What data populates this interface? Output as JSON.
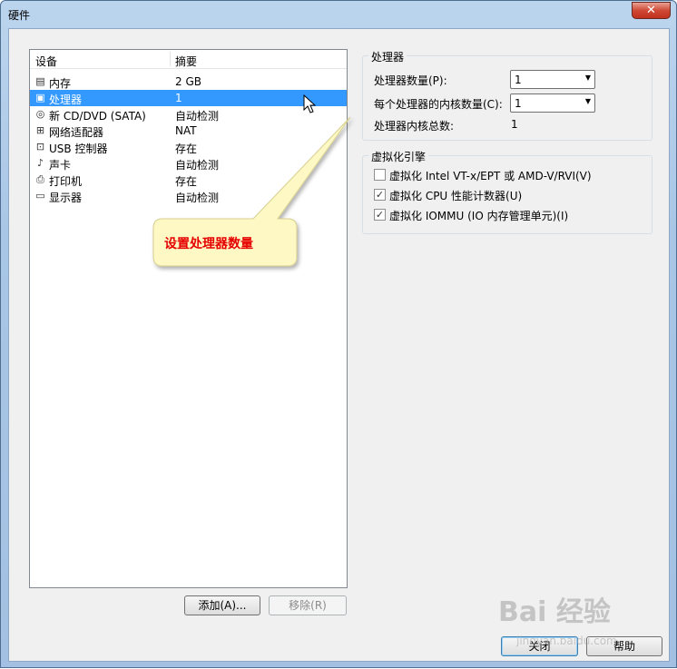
{
  "window": {
    "title": "硬件",
    "close_glyph": "✕"
  },
  "device_list": {
    "header": {
      "device": "设备",
      "summary": "摘要"
    },
    "rows": [
      {
        "icon": "memory-icon",
        "glyph": "▤",
        "name": "内存",
        "summary": "2 GB",
        "selected": false
      },
      {
        "icon": "processor-icon",
        "glyph": "▣",
        "name": "处理器",
        "summary": "1",
        "selected": true
      },
      {
        "icon": "cd-dvd-icon",
        "glyph": "◎",
        "name": "新 CD/DVD (SATA)",
        "summary": "自动检测",
        "selected": false
      },
      {
        "icon": "network-adapter-icon",
        "glyph": "⊞",
        "name": "网络适配器",
        "summary": "NAT",
        "selected": false
      },
      {
        "icon": "usb-controller-icon",
        "glyph": "⊡",
        "name": "USB 控制器",
        "summary": "存在",
        "selected": false
      },
      {
        "icon": "sound-card-icon",
        "glyph": "♪",
        "name": "声卡",
        "summary": "自动检测",
        "selected": false
      },
      {
        "icon": "printer-icon",
        "glyph": "⎙",
        "name": "打印机",
        "summary": "存在",
        "selected": false
      },
      {
        "icon": "display-icon",
        "glyph": "▭",
        "name": "显示器",
        "summary": "自动检测",
        "selected": false
      }
    ],
    "add_button": "添加(A)...",
    "remove_button": "移除(R)"
  },
  "processor": {
    "group_title": "处理器",
    "count_label": "处理器数量(P):",
    "count_value": "1",
    "cores_label": "每个处理器的内核数量(C):",
    "cores_value": "1",
    "total_label": "处理器内核总数:",
    "total_value": "1"
  },
  "virtualization": {
    "group_title": "虚拟化引擎",
    "options": [
      {
        "label": "虚拟化 Intel VT-x/EPT 或 AMD-V/RVI(V)",
        "checked": false
      },
      {
        "label": "虚拟化 CPU 性能计数器(U)",
        "checked": true
      },
      {
        "label": "虚拟化 IOMMU (IO 内存管理单元)(I)",
        "checked": true
      }
    ]
  },
  "callout": {
    "text": "设置处理器数量"
  },
  "footer": {
    "close_button": "关闭",
    "help_button": "帮助"
  },
  "watermark": {
    "text": "Bai 经验",
    "sub": "jingyan.baidu.com"
  },
  "colors": {
    "selection": "#3399ff",
    "callout_text": "#e60000",
    "callout_fill": "#fdf8c4"
  }
}
